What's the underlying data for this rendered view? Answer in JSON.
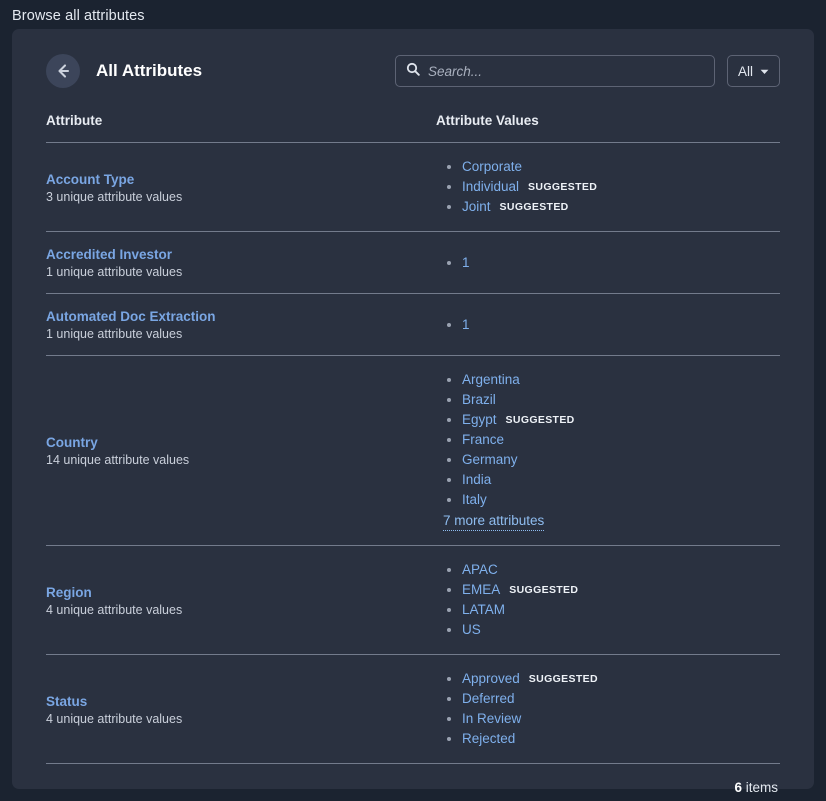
{
  "page": {
    "title": "Browse all attributes"
  },
  "card": {
    "title": "All Attributes",
    "back_icon": "arrow-left-icon"
  },
  "search": {
    "icon": "search-icon",
    "placeholder": "Search...",
    "value": ""
  },
  "filter": {
    "label": "All",
    "icon": "chevron-down-icon"
  },
  "table": {
    "headers": {
      "attribute": "Attribute",
      "values": "Attribute Values"
    },
    "rows": [
      {
        "name": "Account Type",
        "count": "3 unique attribute values",
        "values": [
          {
            "text": "Corporate",
            "badge": ""
          },
          {
            "text": "Individual",
            "badge": "SUGGESTED"
          },
          {
            "text": "Joint",
            "badge": "SUGGESTED"
          }
        ],
        "more": ""
      },
      {
        "name": "Accredited Investor",
        "count": "1 unique attribute values",
        "values": [
          {
            "text": "1",
            "badge": ""
          }
        ],
        "more": ""
      },
      {
        "name": "Automated Doc Extraction",
        "count": "1 unique attribute values",
        "values": [
          {
            "text": "1",
            "badge": ""
          }
        ],
        "more": ""
      },
      {
        "name": "Country",
        "count": "14 unique attribute values",
        "values": [
          {
            "text": "Argentina",
            "badge": ""
          },
          {
            "text": "Brazil",
            "badge": ""
          },
          {
            "text": "Egypt",
            "badge": "SUGGESTED"
          },
          {
            "text": "France",
            "badge": ""
          },
          {
            "text": "Germany",
            "badge": ""
          },
          {
            "text": "India",
            "badge": ""
          },
          {
            "text": "Italy",
            "badge": ""
          }
        ],
        "more": "7 more attributes"
      },
      {
        "name": "Region",
        "count": "4 unique attribute values",
        "values": [
          {
            "text": "APAC",
            "badge": ""
          },
          {
            "text": "EMEA",
            "badge": "SUGGESTED"
          },
          {
            "text": "LATAM",
            "badge": ""
          },
          {
            "text": "US",
            "badge": ""
          }
        ],
        "more": ""
      },
      {
        "name": "Status",
        "count": "4 unique attribute values",
        "values": [
          {
            "text": "Approved",
            "badge": "SUGGESTED"
          },
          {
            "text": "Deferred",
            "badge": ""
          },
          {
            "text": "In Review",
            "badge": ""
          },
          {
            "text": "Rejected",
            "badge": ""
          }
        ],
        "more": ""
      }
    ]
  },
  "footer": {
    "count": "6",
    "label": "items"
  },
  "colors": {
    "page_bg": "#1b2330",
    "card_bg": "#2a3140",
    "link_blue": "#7fb0ec",
    "attr_blue": "#7aa6e3",
    "divider": "#737b8c"
  }
}
